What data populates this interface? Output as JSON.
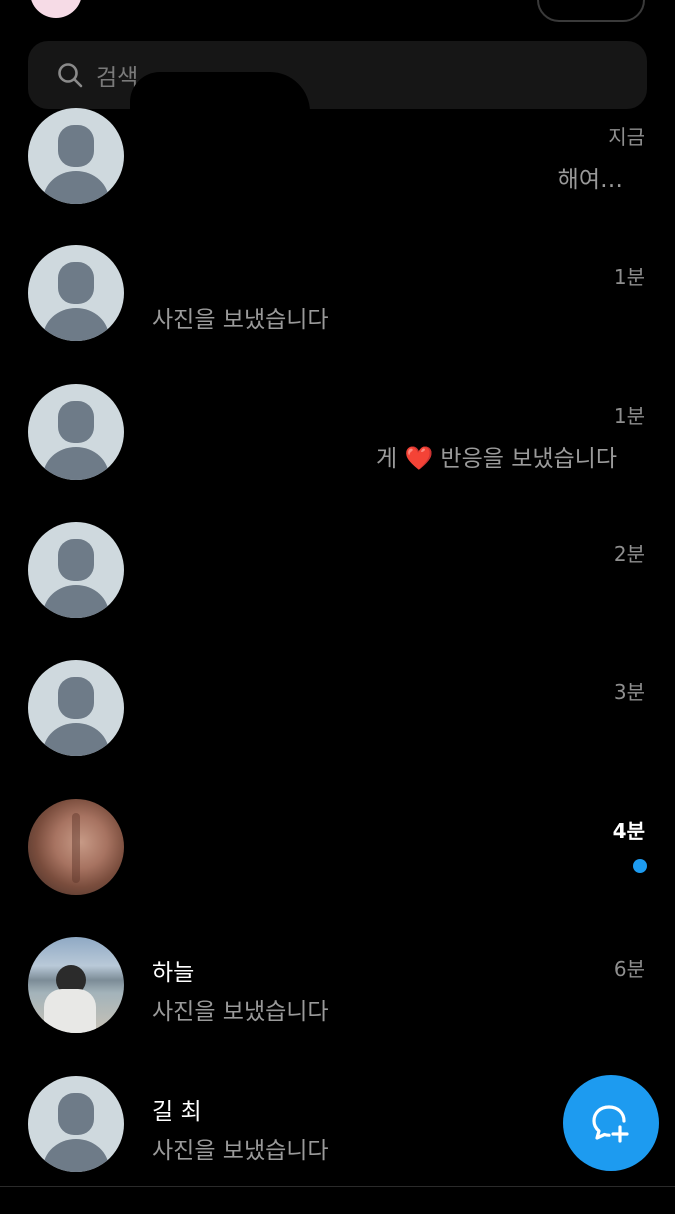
{
  "search": {
    "placeholder": "검색"
  },
  "conversations": [
    {
      "name": "",
      "preview": "해여…",
      "time": "지금",
      "unread": false
    },
    {
      "name": "",
      "preview": "사진을 보냈습니다",
      "time": "1분",
      "unread": false
    },
    {
      "name": "",
      "preview_prefix": "게",
      "preview_emoji": "❤️",
      "preview": "반응을 보냈습니다",
      "time": "1분",
      "unread": false
    },
    {
      "name": "",
      "preview": "",
      "time": "2분",
      "unread": false
    },
    {
      "name": "",
      "preview": "",
      "time": "3분",
      "unread": false
    },
    {
      "name": "",
      "preview": "",
      "time": "4분",
      "unread": true
    },
    {
      "name": "하늘",
      "preview": "사진을 보냈습니다",
      "time": "6분",
      "unread": false
    },
    {
      "name": "길 최",
      "preview": "사진을 보냈습니다",
      "time": "",
      "unread": false
    }
  ],
  "icons": {
    "search": "search-icon",
    "compose": "new-message-icon"
  },
  "colors": {
    "accent": "#1d9bf0",
    "background": "#000000",
    "secondary_text": "#9a9a9a"
  }
}
